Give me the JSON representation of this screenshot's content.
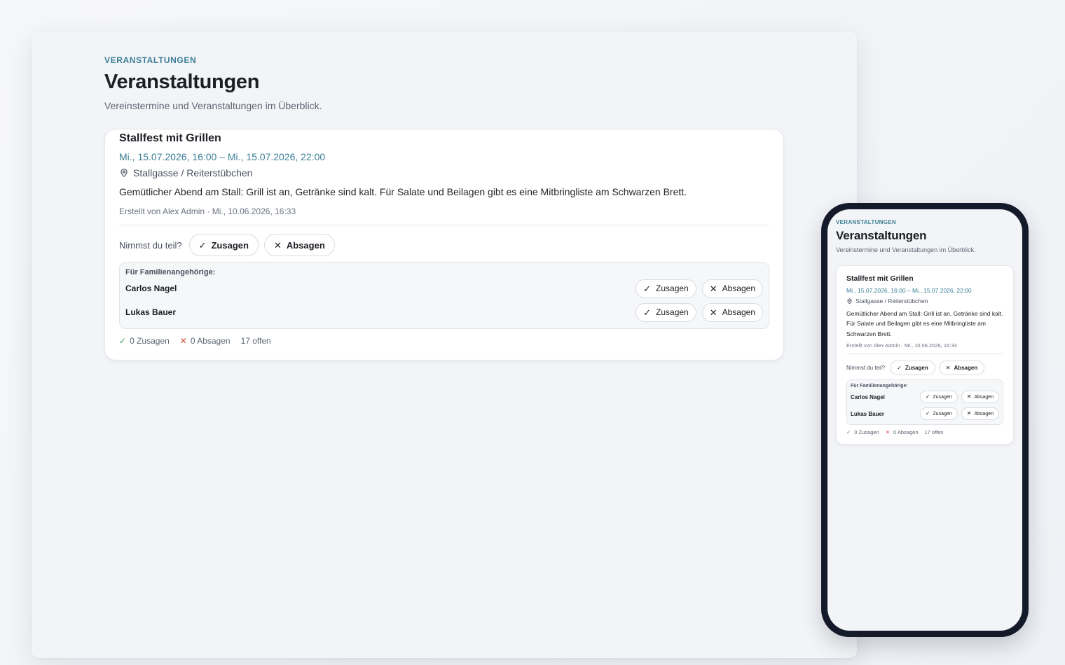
{
  "page": {
    "eyebrow": "VERANSTALTUNGEN",
    "title": "Veranstaltungen",
    "subtitle": "Vereinstermine und Veranstaltungen im Überblick."
  },
  "event": {
    "title": "Stallfest mit Grillen",
    "date": "Mi., 15.07.2026, 16:00 – Mi., 15.07.2026, 22:00",
    "location": "Stallgasse / Reiterstübchen",
    "location_icon": "map-pin-icon",
    "description": "Gemütlicher Abend am Stall: Grill ist an, Getränke sind kalt. Für Salate und Beilagen gibt es eine Mitbringliste am Schwarzen Brett.",
    "meta": "Erstellt von Alex Admin · Mi., 10.06.2026, 16:33"
  },
  "rsvp": {
    "question": "Nimmst du teil?",
    "accept_label": "Zusagen",
    "decline_label": "Absagen",
    "accept_icon": "✓",
    "decline_icon": "✕"
  },
  "family": {
    "label": "Für Familienangehörige:",
    "members": [
      {
        "name": "Carlos Nagel"
      },
      {
        "name": "Lukas Bauer"
      }
    ]
  },
  "stats": {
    "accepted": "0 Zusagen",
    "declined": "0 Absagen",
    "open": "17 offen"
  },
  "colors": {
    "accent": "#3b7f96",
    "ok": "#2f9e5b",
    "no": "#d9463b"
  }
}
